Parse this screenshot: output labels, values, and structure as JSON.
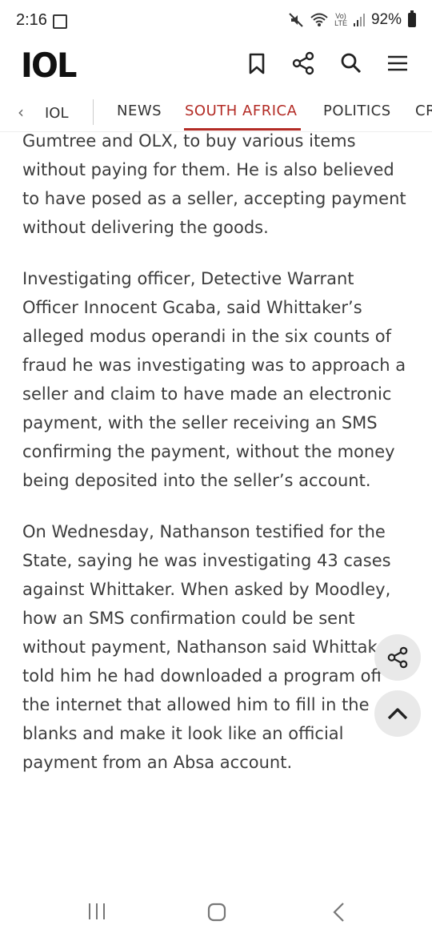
{
  "status_bar": {
    "time": "2:16",
    "volte": "Vo)",
    "lte": "LTE",
    "battery": "92%"
  },
  "header": {
    "logo": "IOL",
    "icons": [
      "bookmark-icon",
      "share-icon",
      "search-icon",
      "menu-icon"
    ]
  },
  "sections": {
    "back": "IOL",
    "items": [
      "NEWS",
      "SOUTH AFRICA",
      "POLITICS",
      "CR"
    ],
    "active_index": 1
  },
  "article": {
    "paragraphs": [
      "Gumtree and OLX, to buy various items without paying for them. He is also believed to have posed as a seller, accepting payment without delivering the goods.",
      "Investigating officer, Detective Warrant Officer Innocent Gcaba, said Whittaker’s alleged modus operandi in the six counts of fraud he was investigating was to approach a seller and claim to have made an electronic payment, with the seller receiving an SMS confirming the payment, without the money being deposited into the seller’s account.",
      "On Wednesday, Nathanson testified for the State, saying he was investigating 43 cases against Whittaker. When asked by Moodley, how an SMS confirmation could be sent without payment, Nathanson said Whittaker told him he had downloaded a program off the internet that allowed him to fill in the blanks and make it look like an official payment from an Absa account."
    ]
  },
  "colors": {
    "accent": "#b32b25",
    "text": "#3c3c3c",
    "fab_bg": "#e9e9e9"
  }
}
